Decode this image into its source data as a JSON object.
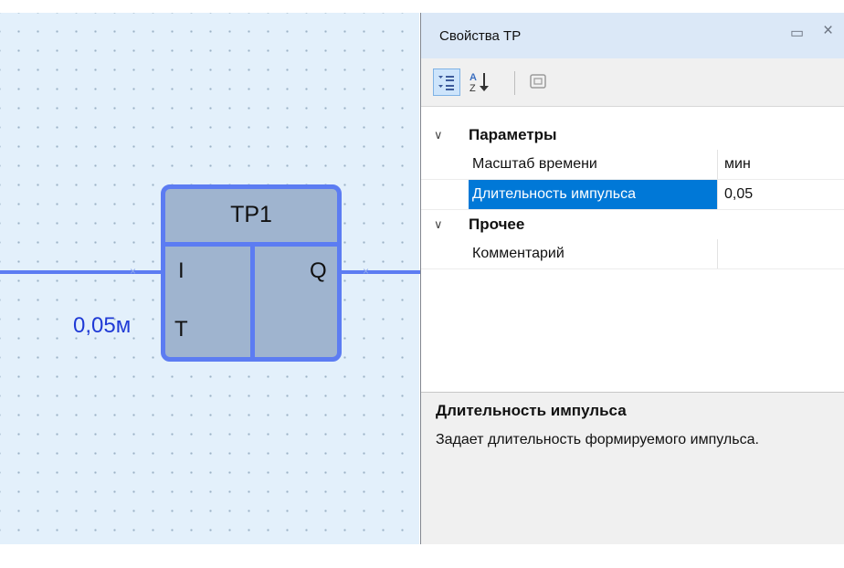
{
  "canvas": {
    "block": {
      "title": "TP1",
      "input_i": "I",
      "input_t": "T",
      "output_q": "Q"
    },
    "t_value": "0,05м"
  },
  "panel": {
    "title": "Свойства TP",
    "restore_glyph": "▭",
    "close_glyph": "×",
    "toolbar": {
      "categorized_icon": "categorized-icon",
      "alphabetical_icon": "sort-alpha-icon",
      "property_pages_icon": "property-pages-icon"
    },
    "categories": [
      {
        "label": "Параметры",
        "expander": "∨",
        "properties": [
          {
            "name": "Масштаб времени",
            "value": "мин"
          },
          {
            "name": "Длительность импульса",
            "value": "0,05"
          }
        ]
      },
      {
        "label": "Прочее",
        "expander": "∨",
        "properties": [
          {
            "name": "Комментарий",
            "value": ""
          }
        ]
      }
    ],
    "description": {
      "title": "Длительность импульса",
      "text": "Задает длительность формируемого импульса."
    }
  },
  "colors": {
    "accent": "#5c7cf2",
    "selection": "#0078d7",
    "value_text": "#1f3ad6"
  }
}
